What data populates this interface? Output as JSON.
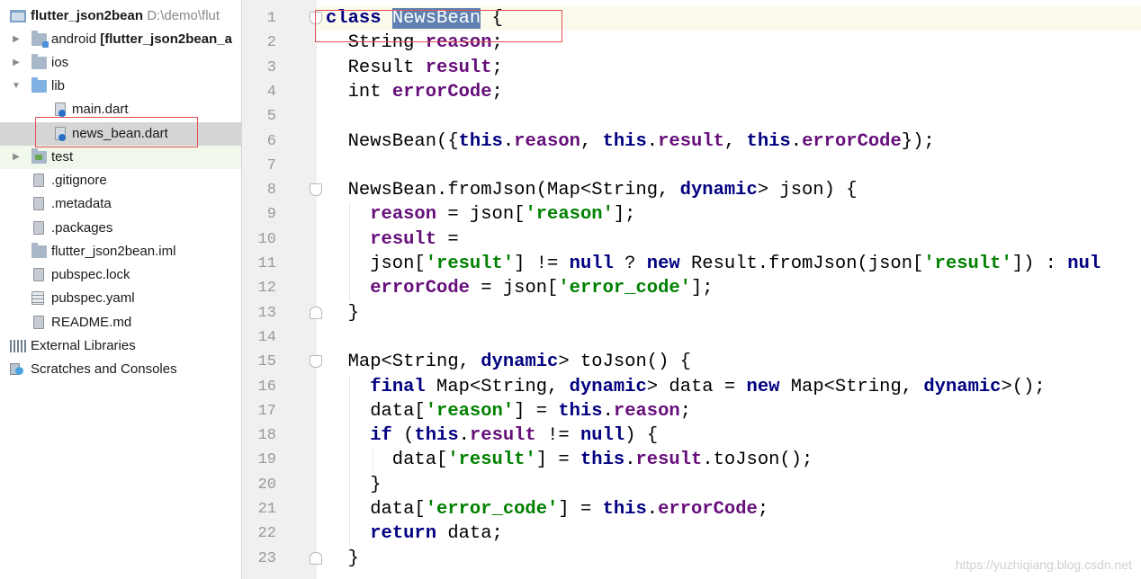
{
  "project": {
    "root_name": "flutter_json2bean",
    "root_path": "D:\\demo\\flut",
    "items": [
      {
        "label": "android",
        "extra": "[flutter_json2bean_a",
        "icon": "android-folder-icon"
      },
      {
        "label": "ios",
        "icon": "folder-icon"
      },
      {
        "label": "lib",
        "icon": "folder-icon"
      },
      {
        "label": "main.dart",
        "icon": "dart-file-icon"
      },
      {
        "label": "news_bean.dart",
        "icon": "dart-file-icon"
      },
      {
        "label": "test",
        "icon": "test-folder-icon"
      },
      {
        "label": ".gitignore",
        "icon": "file-icon"
      },
      {
        "label": ".metadata",
        "icon": "file-icon"
      },
      {
        "label": ".packages",
        "icon": "file-icon"
      },
      {
        "label": "flutter_json2bean.iml",
        "icon": "module-file-icon"
      },
      {
        "label": "pubspec.lock",
        "icon": "file-icon"
      },
      {
        "label": "pubspec.yaml",
        "icon": "yaml-file-icon"
      },
      {
        "label": "README.md",
        "icon": "file-icon"
      },
      {
        "label": "External Libraries",
        "icon": "libraries-icon"
      },
      {
        "label": "Scratches and Consoles",
        "icon": "scratches-icon"
      }
    ]
  },
  "editor": {
    "lines": [
      {
        "n": "1",
        "code": [
          {
            "t": "class ",
            "c": "kw"
          },
          {
            "t": "NewsBean",
            "c": "sel"
          },
          {
            "t": " {"
          }
        ]
      },
      {
        "n": "2",
        "code": [
          {
            "t": "  String "
          },
          {
            "t": "reason",
            "c": "field"
          },
          {
            "t": ";"
          }
        ]
      },
      {
        "n": "3",
        "code": [
          {
            "t": "  Result "
          },
          {
            "t": "result",
            "c": "field"
          },
          {
            "t": ";"
          }
        ]
      },
      {
        "n": "4",
        "code": [
          {
            "t": "  int "
          },
          {
            "t": "errorCode",
            "c": "field"
          },
          {
            "t": ";"
          }
        ]
      },
      {
        "n": "5",
        "code": []
      },
      {
        "n": "6",
        "code": [
          {
            "t": "  NewsBean({"
          },
          {
            "t": "this",
            "c": "kw"
          },
          {
            "t": "."
          },
          {
            "t": "reason",
            "c": "field"
          },
          {
            "t": ", "
          },
          {
            "t": "this",
            "c": "kw"
          },
          {
            "t": "."
          },
          {
            "t": "result",
            "c": "field"
          },
          {
            "t": ", "
          },
          {
            "t": "this",
            "c": "kw"
          },
          {
            "t": "."
          },
          {
            "t": "errorCode",
            "c": "field"
          },
          {
            "t": "});"
          }
        ]
      },
      {
        "n": "7",
        "code": []
      },
      {
        "n": "8",
        "code": [
          {
            "t": "  NewsBean.fromJson(Map<String, "
          },
          {
            "t": "dynamic",
            "c": "kw"
          },
          {
            "t": "> json) {"
          }
        ]
      },
      {
        "n": "9",
        "code": [
          {
            "t": "    "
          },
          {
            "t": "reason",
            "c": "field"
          },
          {
            "t": " = json["
          },
          {
            "t": "'reason'",
            "c": "str"
          },
          {
            "t": "];"
          }
        ]
      },
      {
        "n": "10",
        "code": [
          {
            "t": "    "
          },
          {
            "t": "result",
            "c": "field"
          },
          {
            "t": " ="
          }
        ]
      },
      {
        "n": "11",
        "code": [
          {
            "t": "    json["
          },
          {
            "t": "'result'",
            "c": "str"
          },
          {
            "t": "] != "
          },
          {
            "t": "null",
            "c": "kw"
          },
          {
            "t": " ? "
          },
          {
            "t": "new",
            "c": "kw"
          },
          {
            "t": " Result.fromJson(json["
          },
          {
            "t": "'result'",
            "c": "str"
          },
          {
            "t": "]) : "
          },
          {
            "t": "nul",
            "c": "kw"
          }
        ]
      },
      {
        "n": "12",
        "code": [
          {
            "t": "    "
          },
          {
            "t": "errorCode",
            "c": "field"
          },
          {
            "t": " = json["
          },
          {
            "t": "'error_code'",
            "c": "str"
          },
          {
            "t": "];"
          }
        ]
      },
      {
        "n": "13",
        "code": [
          {
            "t": "  }"
          }
        ]
      },
      {
        "n": "14",
        "code": []
      },
      {
        "n": "15",
        "code": [
          {
            "t": "  Map<String, "
          },
          {
            "t": "dynamic",
            "c": "kw"
          },
          {
            "t": "> toJson() {"
          }
        ]
      },
      {
        "n": "16",
        "code": [
          {
            "t": "    "
          },
          {
            "t": "final",
            "c": "kw"
          },
          {
            "t": " Map<String, "
          },
          {
            "t": "dynamic",
            "c": "kw"
          },
          {
            "t": "> data = "
          },
          {
            "t": "new",
            "c": "kw"
          },
          {
            "t": " Map<String, "
          },
          {
            "t": "dynamic",
            "c": "kw"
          },
          {
            "t": ">();"
          }
        ]
      },
      {
        "n": "17",
        "code": [
          {
            "t": "    data["
          },
          {
            "t": "'reason'",
            "c": "str"
          },
          {
            "t": "] = "
          },
          {
            "t": "this",
            "c": "kw"
          },
          {
            "t": "."
          },
          {
            "t": "reason",
            "c": "field"
          },
          {
            "t": ";"
          }
        ]
      },
      {
        "n": "18",
        "code": [
          {
            "t": "    "
          },
          {
            "t": "if",
            "c": "kw"
          },
          {
            "t": " ("
          },
          {
            "t": "this",
            "c": "kw"
          },
          {
            "t": "."
          },
          {
            "t": "result",
            "c": "field"
          },
          {
            "t": " != "
          },
          {
            "t": "null",
            "c": "kw"
          },
          {
            "t": ") {"
          }
        ]
      },
      {
        "n": "19",
        "code": [
          {
            "t": "      data["
          },
          {
            "t": "'result'",
            "c": "str"
          },
          {
            "t": "] = "
          },
          {
            "t": "this",
            "c": "kw"
          },
          {
            "t": "."
          },
          {
            "t": "result",
            "c": "field"
          },
          {
            "t": ".toJson();"
          }
        ]
      },
      {
        "n": "20",
        "code": [
          {
            "t": "    }"
          }
        ]
      },
      {
        "n": "21",
        "code": [
          {
            "t": "    data["
          },
          {
            "t": "'error_code'",
            "c": "str"
          },
          {
            "t": "] = "
          },
          {
            "t": "this",
            "c": "kw"
          },
          {
            "t": "."
          },
          {
            "t": "errorCode",
            "c": "field"
          },
          {
            "t": ";"
          }
        ]
      },
      {
        "n": "22",
        "code": [
          {
            "t": "    "
          },
          {
            "t": "return",
            "c": "kw"
          },
          {
            "t": " data;"
          }
        ]
      },
      {
        "n": "23",
        "code": [
          {
            "t": "  }"
          }
        ]
      }
    ]
  },
  "watermark": "https://yuzhiqiang.blog.csdn.net",
  "colors": {
    "keyword": "#000080",
    "field": "#660e7a",
    "string": "#008000",
    "selection": "#5f80b0",
    "annotation_box": "#e05050"
  }
}
